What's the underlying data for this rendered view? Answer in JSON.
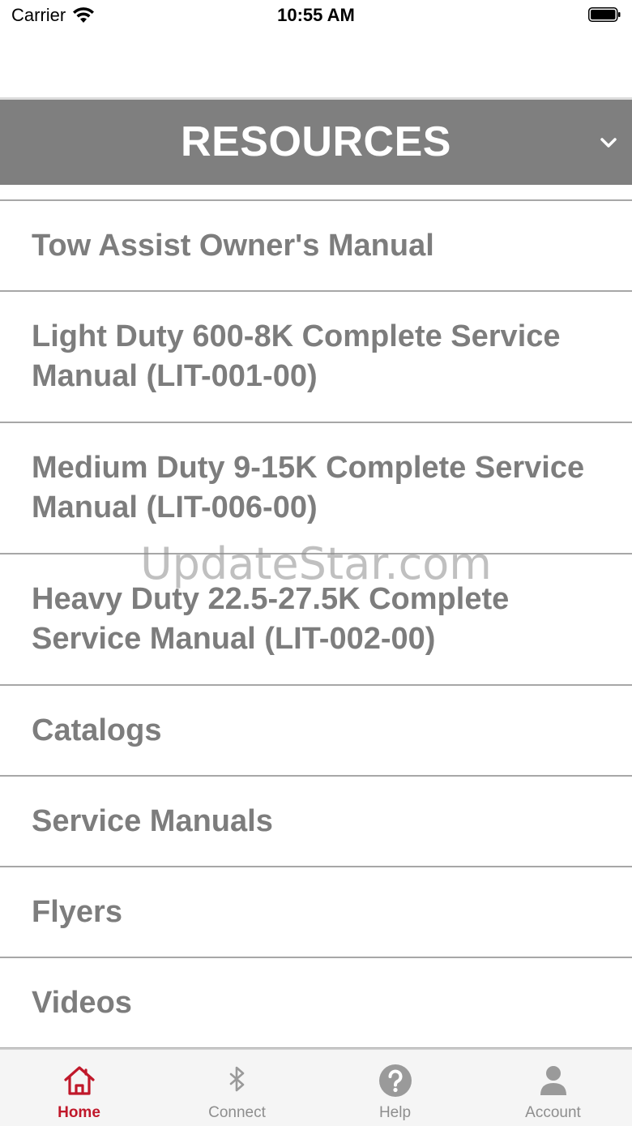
{
  "status_bar": {
    "carrier": "Carrier",
    "time": "10:55 AM"
  },
  "header": {
    "title": "RESOURCES",
    "expand_icon": "chevron-down-icon"
  },
  "list": {
    "items": [
      {
        "label": "Tow Assist Owner's Manual"
      },
      {
        "label": "Light Duty 600-8K Complete Service Manual (LIT-001-00)"
      },
      {
        "label": "Medium Duty 9-15K Complete Service Manual (LIT-006-00)"
      },
      {
        "label": "Heavy Duty 22.5-27.5K Complete Service Manual (LIT-002-00)"
      },
      {
        "label": "Catalogs"
      },
      {
        "label": "Service Manuals"
      },
      {
        "label": "Flyers"
      },
      {
        "label": "Videos"
      }
    ]
  },
  "watermark": "UpdateStar.com",
  "tab_bar": {
    "tabs": [
      {
        "label": "Home",
        "icon": "home-icon",
        "active": true
      },
      {
        "label": "Connect",
        "icon": "bluetooth-icon",
        "active": false
      },
      {
        "label": "Help",
        "icon": "help-icon",
        "active": false
      },
      {
        "label": "Account",
        "icon": "account-icon",
        "active": false
      }
    ]
  },
  "colors": {
    "header_bg": "#7f7f7f",
    "list_text": "#7d7d7d",
    "active_tab": "#c0182a",
    "inactive_tab": "#8e8e8e"
  }
}
